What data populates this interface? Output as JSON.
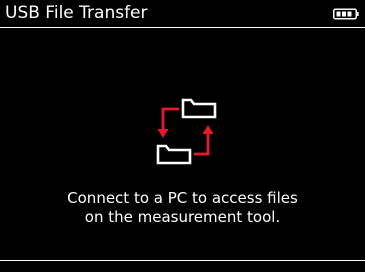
{
  "header": {
    "title": "USB File Transfer",
    "battery_icon": "battery-full-icon"
  },
  "main": {
    "icon": "file-transfer-icon",
    "message_line_1": "Connect to a PC to access files",
    "message_line_2": "on the measurement tool."
  },
  "colors": {
    "background": "#000000",
    "foreground": "#ffffff",
    "accent": "#e8192c"
  }
}
